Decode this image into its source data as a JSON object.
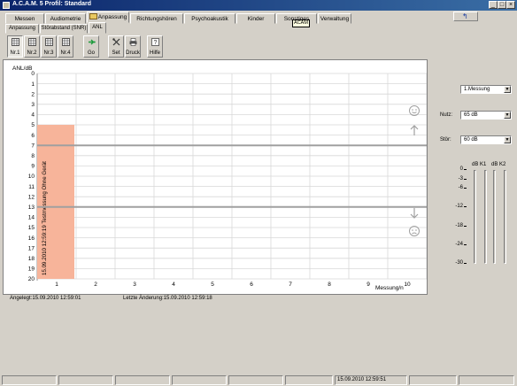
{
  "window": {
    "title": "A.C.A.M. 5  Profil: Standard",
    "minimize": "_",
    "maximize": "□",
    "close": "×"
  },
  "main_tabs": [
    {
      "label": "Messen"
    },
    {
      "label": "Audiometrie"
    },
    {
      "label": "Anpassung"
    },
    {
      "label": "Richtungshören"
    },
    {
      "label": "Psychoakustik"
    },
    {
      "label": "Kinder"
    },
    {
      "label": "Sonstiges"
    },
    {
      "label": "Verwaltung"
    }
  ],
  "tooltip": "ACAM",
  "sub_tabs": [
    {
      "label": "Anpassung"
    },
    {
      "label": "Störabstand (SNR)"
    },
    {
      "label": "ANL"
    }
  ],
  "toolbar": [
    {
      "label": "Nr.1",
      "icon": "grid-icon"
    },
    {
      "label": "Nr.2",
      "icon": "grid-icon"
    },
    {
      "label": "Nr.3",
      "icon": "grid-icon"
    },
    {
      "label": "Nr.4",
      "icon": "grid-icon"
    },
    {
      "label": "Go",
      "icon": "go-icon"
    },
    {
      "label": "Set",
      "icon": "tools-icon"
    },
    {
      "label": "Druck",
      "icon": "printer-icon"
    },
    {
      "label": "Hilfe",
      "icon": "help-icon"
    }
  ],
  "chart_data": {
    "type": "bar",
    "ylabel": "ANL/dB",
    "xlabel": "Messung/n",
    "ylim": [
      0,
      20
    ],
    "y_inverted": true,
    "yticks": [
      0,
      1,
      2,
      3,
      4,
      5,
      6,
      7,
      8,
      9,
      10,
      11,
      12,
      13,
      14,
      15,
      16,
      17,
      18,
      19,
      20
    ],
    "x_categories": [
      1,
      2,
      3,
      4,
      5,
      6,
      7,
      8,
      9,
      10
    ],
    "values": [
      5,
      null,
      null,
      null,
      null,
      null,
      null,
      null,
      null,
      null
    ],
    "bar_color": "#f7b49a",
    "bar_label": "15.09.2010 12:59:19   Testmessung Ohne Gerät",
    "reference_lines": [
      7,
      13
    ],
    "grid": true
  },
  "side_icons": [
    "smile-icon",
    "arrow-up-icon",
    "arrow-down-icon",
    "frown-icon"
  ],
  "info": {
    "angelegt": "Angelegt:15.09.2010 12:59:01",
    "letzte_aenderung": "Letzte Änderung:15.09.2010 12:59:18"
  },
  "controls": {
    "measurement_select": "1.Messung",
    "nutz_label": "Nutz:",
    "nutz_value": "65 dB",
    "stoer_label": "Stör:",
    "stoer_value": "60 dB"
  },
  "level_meters": {
    "headers": [
      "dB K1",
      "dB K2"
    ],
    "scale": [
      "0",
      "-3",
      "-6",
      "-12",
      "-18",
      "-24",
      "-30"
    ]
  },
  "statusbar": {
    "datetime": "15.09.2010 12:59:51"
  }
}
